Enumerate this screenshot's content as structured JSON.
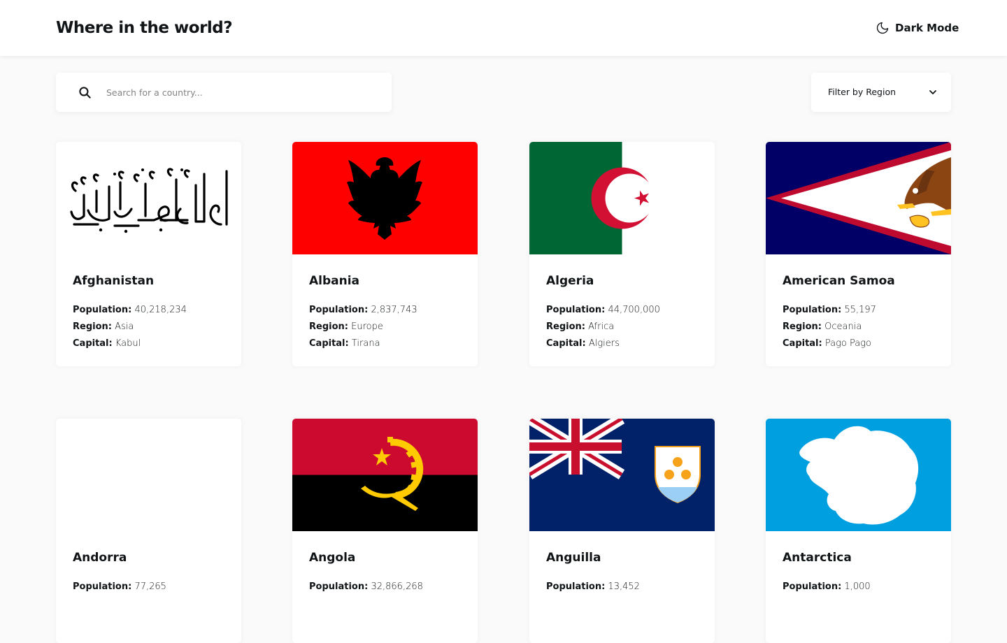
{
  "header": {
    "title": "Where in the world?",
    "theme_toggle_label": "Dark Mode",
    "theme_icon": "moon-icon"
  },
  "search": {
    "placeholder": "Search for a country...",
    "value": "",
    "icon": "search-icon"
  },
  "filter": {
    "label": "Filter by Region",
    "icon": "chevron-down-icon"
  },
  "info_labels": {
    "population": "Population:",
    "region": "Region:",
    "capital": "Capital:"
  },
  "countries": [
    {
      "name": "Afghanistan",
      "population": "40,218,234",
      "region": "Asia",
      "capital": "Kabul",
      "flag": "afghanistan-flag"
    },
    {
      "name": "Albania",
      "population": "2,837,743",
      "region": "Europe",
      "capital": "Tirana",
      "flag": "albania-flag"
    },
    {
      "name": "Algeria",
      "population": "44,700,000",
      "region": "Africa",
      "capital": "Algiers",
      "flag": "algeria-flag"
    },
    {
      "name": "American Samoa",
      "population": "55,197",
      "region": "Oceania",
      "capital": "Pago Pago",
      "flag": "american-samoa-flag"
    },
    {
      "name": "Andorra",
      "population": "77,265",
      "flag": "andorra-flag"
    },
    {
      "name": "Angola",
      "population": "32,866,268",
      "flag": "angola-flag"
    },
    {
      "name": "Anguilla",
      "population": "13,452",
      "flag": "anguilla-flag"
    },
    {
      "name": "Antarctica",
      "population": "1,000",
      "flag": "antarctica-flag"
    }
  ],
  "colors": {
    "background": "#fafafa",
    "surface": "#ffffff",
    "text": "#111517",
    "placeholder": "#848484"
  }
}
